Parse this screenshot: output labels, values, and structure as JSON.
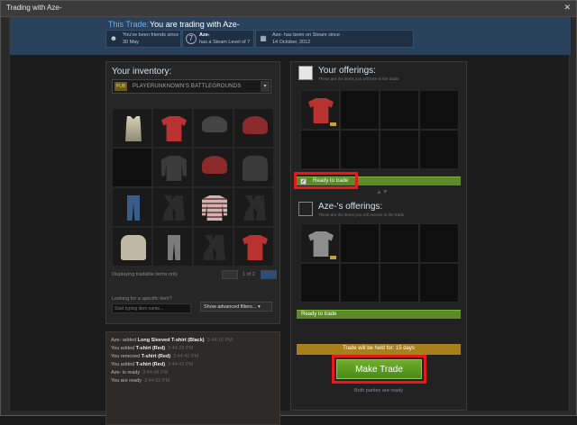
{
  "window": {
    "title": "Trading with Aze-",
    "close_glyph": "✕"
  },
  "header": {
    "label": "This Trade:",
    "text": "You are trading with Aze-",
    "info": [
      {
        "icon": "user-icon",
        "lines": [
          "You've been friends since",
          "30 May"
        ]
      },
      {
        "icon": "level-icon",
        "lines": [
          "Aze-",
          "has a Steam Level of 7"
        ],
        "badge": "7"
      },
      {
        "icon": "calendar-icon",
        "lines": [
          "Aze- has been on Steam since",
          "14 October, 2012"
        ]
      }
    ]
  },
  "inventory": {
    "title": "Your inventory:",
    "game": "PLAYERUNKNOWN'S BATTLEGROUNDS",
    "game_icon": "PUB",
    "items": [
      "tank",
      "tshirt-red",
      "cap-gray",
      "cap-red",
      "empty",
      "tshirt-black",
      "cap-red",
      "glove",
      "jeans",
      "boots",
      "striped",
      "boots",
      "glove-lt",
      "pants",
      "boots",
      "tshirt-red"
    ],
    "footer_note": "Displaying tradable items only",
    "page": "1 of 2",
    "search_label": "Looking for a specific item?",
    "search_placeholder": "Start typing item name...",
    "advanced_label": "Show advanced filters..."
  },
  "yours": {
    "title": "Your offerings:",
    "subtitle": "These are the items you will lose in the trade.",
    "items": [
      "tshirt-red",
      "empty",
      "empty",
      "empty",
      "empty",
      "empty",
      "empty",
      "empty"
    ],
    "ready_label": "Ready to trade"
  },
  "theirs": {
    "title": "Aze-'s offerings:",
    "subtitle": "These are the items you will receive in the trade.",
    "items": [
      "tshirt-gray",
      "empty",
      "empty",
      "empty",
      "empty",
      "empty",
      "empty",
      "empty"
    ],
    "ready_label": "Ready to trade"
  },
  "held_text": "Trade will be held for: 15 days",
  "make_trade_label": "Make Trade",
  "both_ready_text": "Both parties are ready",
  "log": [
    {
      "text": "Aze- added ",
      "bold": "Long Sleeved T-shirt (Black)",
      "time": "3:44:16 PM"
    },
    {
      "text": "You added ",
      "bold": "T-shirt (Red)",
      "time": "3:44:28 PM"
    },
    {
      "text": "You removed ",
      "bold": "T-shirt (Red)",
      "time": "3:44:41 PM"
    },
    {
      "text": "You added ",
      "bold": "T-shirt (Red)",
      "time": "3:44:43 PM"
    },
    {
      "text": "Aze- is ready",
      "bold": "",
      "time": "3:44:48 PM"
    },
    {
      "text": "You are ready",
      "bold": "",
      "time": "3:44:55 PM"
    }
  ],
  "colors": {
    "accent_blue": "#6ab2f0",
    "ready_green": "#5c8a29",
    "held_gold": "#a7801c",
    "highlight_red": "#e31b1b"
  }
}
